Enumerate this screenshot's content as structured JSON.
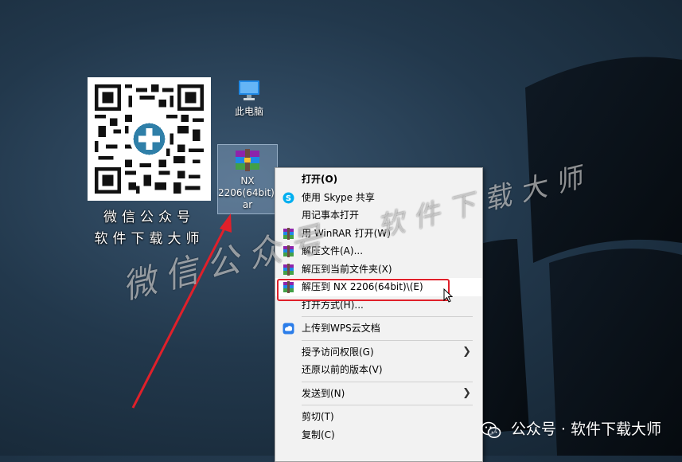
{
  "qr": {
    "caption_line1": "微信公众号",
    "caption_line2": "软件下载大师"
  },
  "desktop": {
    "this_pc_label": "此电脑",
    "archive_label_line1": "NX",
    "archive_label_line2": "2206(64bit).",
    "archive_label_line3": "ar"
  },
  "context_menu": {
    "items": [
      {
        "label": "打开(O)",
        "bold": true
      },
      {
        "label": "使用 Skype 共享",
        "icon": "skype-icon"
      },
      {
        "label": "用记事本打开"
      },
      {
        "label": "用 WinRAR 打开(W)",
        "icon": "winrar-icon"
      },
      {
        "label": "解压文件(A)...",
        "icon": "winrar-icon"
      },
      {
        "label": "解压到当前文件夹(X)",
        "icon": "winrar-icon"
      },
      {
        "label": "解压到 NX 2206(64bit)\\(E)",
        "icon": "winrar-icon",
        "highlighted": true
      },
      {
        "label": "打开方式(H)..."
      },
      {
        "label": "上传到WPS云文档",
        "icon": "wps-cloud-icon"
      },
      {
        "label": "授予访问权限(G)",
        "submenu": true
      },
      {
        "label": "还原以前的版本(V)"
      },
      {
        "label": "发送到(N)",
        "submenu": true
      },
      {
        "label": "剪切(T)"
      },
      {
        "label": "复制(C)"
      }
    ]
  },
  "watermarks": {
    "overlay_1": "微信公众号",
    "overlay_2": "软件下载大师"
  },
  "footer": {
    "text": "公众号 · 软件下载大师"
  },
  "colors": {
    "highlight_box": "#e0202a",
    "menu_bg": "#f2f2f2",
    "arrow": "#e0202a"
  }
}
